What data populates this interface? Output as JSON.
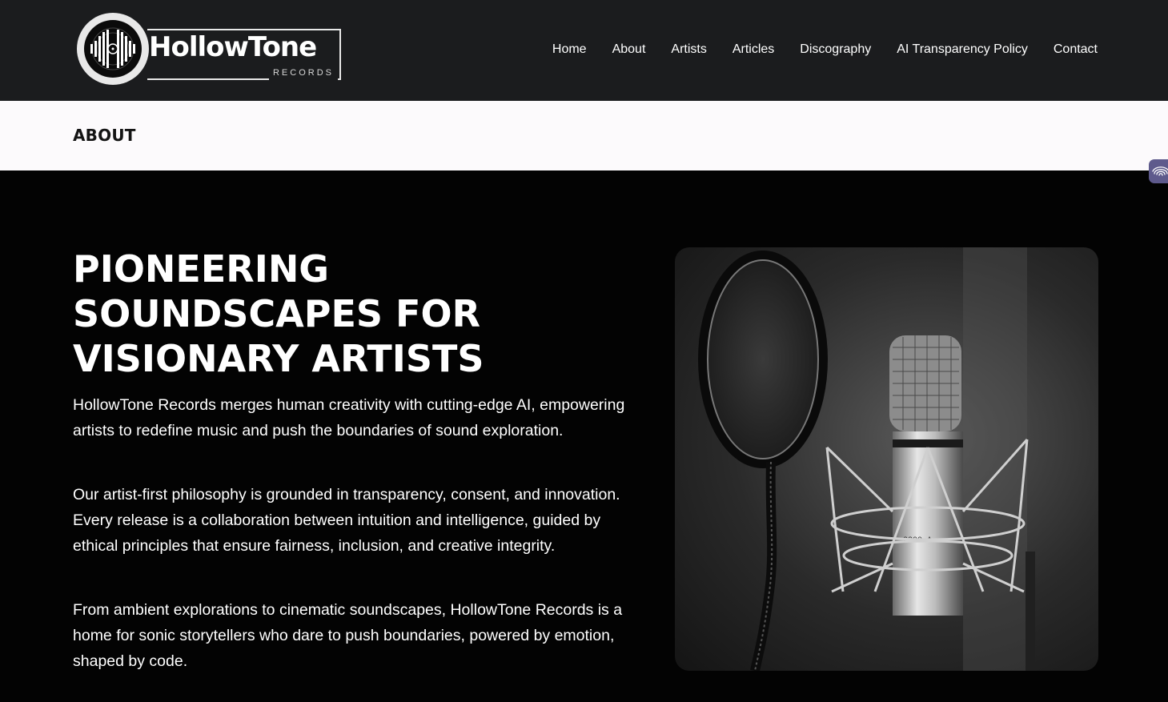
{
  "header": {
    "logo": {
      "word": "HollowTone",
      "sub": "RECORDS"
    },
    "nav": [
      {
        "label": "Home"
      },
      {
        "label": "About"
      },
      {
        "label": "Artists"
      },
      {
        "label": "Articles"
      },
      {
        "label": "Discography"
      },
      {
        "label": "AI Transparency Policy"
      },
      {
        "label": "Contact"
      }
    ]
  },
  "breadcrumb": {
    "title": "ABOUT"
  },
  "hero": {
    "title_lines": [
      "PIONEERING",
      "SOUNDSCAPES FOR",
      "VISIONARY ARTISTS"
    ],
    "paragraphs": [
      "HollowTone Records merges human creativity with cutting-edge AI, empowering artists to redefine music and push the boundaries of sound exploration.",
      "Our artist-first philosophy is grounded in transparency, consent, and innovation. Every release is a collaboration between intuition and intelligence, guided by ethical principles that ensure fairness, inclusion, and creative integrity.",
      "From ambient explorations to cinematic soundscapes, HollowTone Records is a home for sonic storytellers who dare to push boundaries, powered by emotion, shaped by code."
    ],
    "image": {
      "icon": "studio-microphone-photo",
      "mic_label": "2200 A"
    }
  },
  "side_tab": {
    "icon": "fingerprint-icon",
    "color": "#5e5a8c"
  },
  "colors": {
    "header_bg": "#1b1c1e",
    "page_bg": "#030303",
    "crumb_bg": "#fcfafc"
  }
}
